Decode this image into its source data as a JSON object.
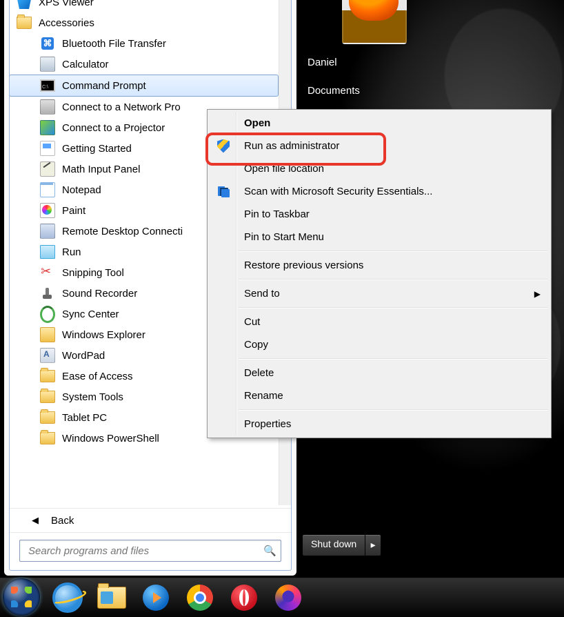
{
  "user": {
    "name": "Daniel"
  },
  "right_pane": {
    "items": [
      {
        "label": "Daniel"
      },
      {
        "label": "Documents"
      }
    ]
  },
  "shutdown": {
    "label": "Shut down",
    "arrow": "▸"
  },
  "search": {
    "placeholder": "Search programs and files"
  },
  "back": {
    "label": "Back"
  },
  "tree": {
    "xps": "XPS Viewer",
    "accessories": "Accessories",
    "bluetooth": "Bluetooth File Transfer",
    "calculator": "Calculator",
    "cmd": "Command Prompt",
    "connect_np": "Connect to a Network Pro",
    "connect_proj": "Connect to a Projector",
    "getting_started": "Getting Started",
    "math_input": "Math Input Panel",
    "notepad": "Notepad",
    "paint": "Paint",
    "rdc": "Remote Desktop Connecti",
    "run": "Run",
    "snip": "Snipping Tool",
    "sound_rec": "Sound Recorder",
    "sync": "Sync Center",
    "we": "Windows Explorer",
    "wordpad": "WordPad",
    "ease": "Ease of Access",
    "systools": "System Tools",
    "tablet": "Tablet PC",
    "powershell": "Windows PowerShell"
  },
  "context_menu": {
    "open": "Open",
    "run_admin": "Run as administrator",
    "open_loc": "Open file location",
    "scan": "Scan with Microsoft Security Essentials...",
    "pin_tb": "Pin to Taskbar",
    "pin_sm": "Pin to Start Menu",
    "restore": "Restore previous versions",
    "send_to": "Send to",
    "cut": "Cut",
    "copy": "Copy",
    "delete": "Delete",
    "rename": "Rename",
    "properties": "Properties",
    "submenu_arrow": "▶"
  }
}
